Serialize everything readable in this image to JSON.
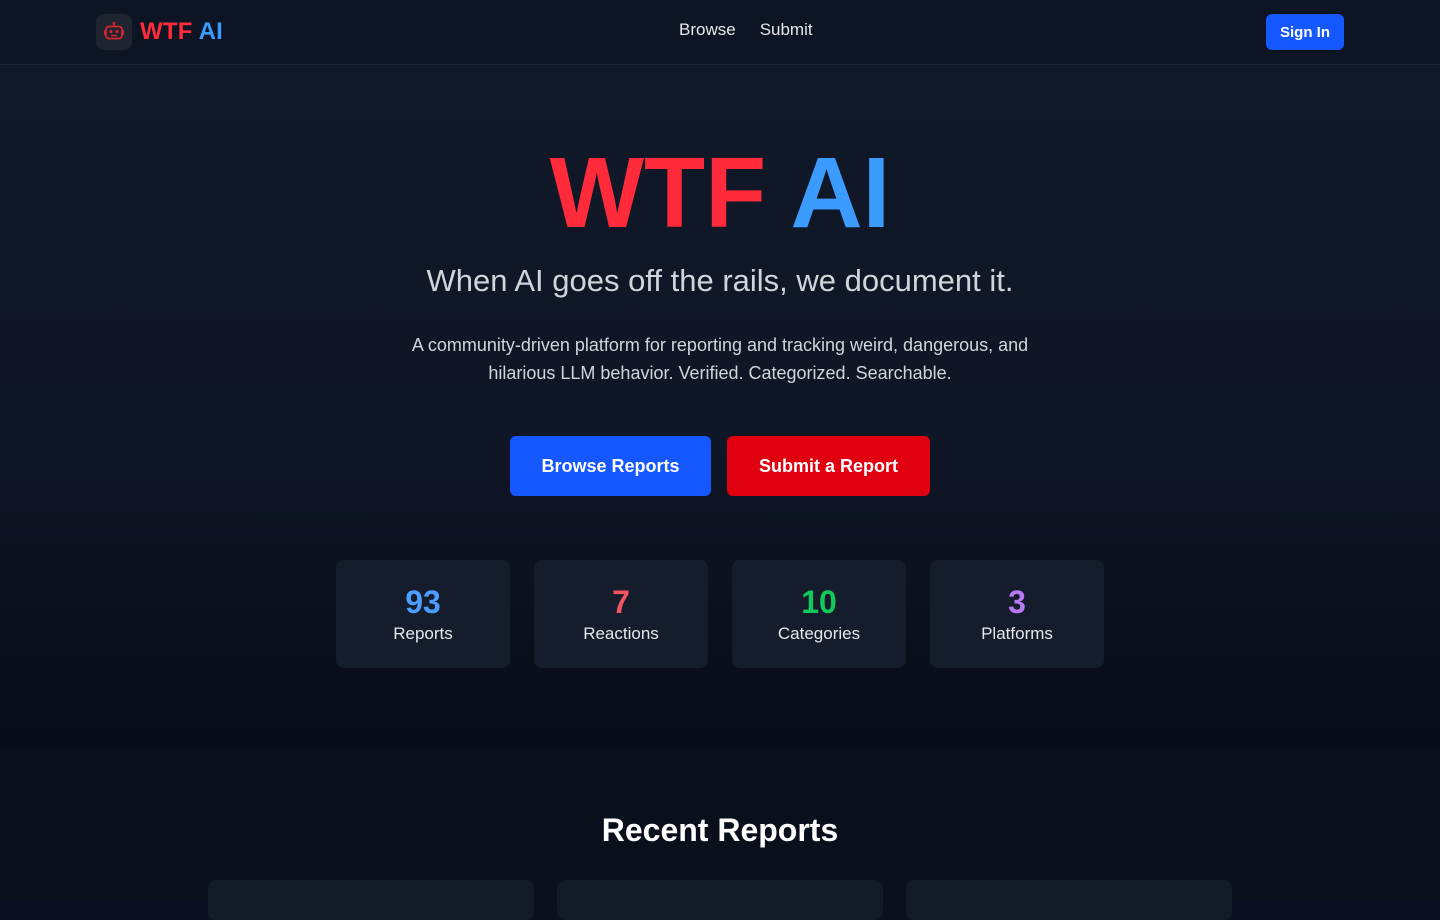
{
  "nav": {
    "logo": {
      "part1": "WTF",
      "part2": "AI",
      "icon": "robot-icon"
    },
    "links": [
      "Browse",
      "Submit"
    ],
    "signin": "Sign In"
  },
  "hero": {
    "title_part1": "WTF",
    "title_part2": "AI",
    "tagline": "When AI goes off the rails, we document it.",
    "description": "A community-driven platform for reporting and tracking weird, dangerous, and hilarious LLM behavior. Verified. Categorized. Searchable.",
    "browse_button": "Browse Reports",
    "submit_button": "Submit a Report"
  },
  "stats": [
    {
      "value": "93",
      "label": "Reports",
      "color": "#4b9dff"
    },
    {
      "value": "7",
      "label": "Reactions",
      "color": "#f0555e"
    },
    {
      "value": "10",
      "label": "Categories",
      "color": "#12c95c"
    },
    {
      "value": "3",
      "label": "Platforms",
      "color": "#b879f5"
    }
  ],
  "recent": {
    "title": "Recent Reports"
  },
  "colors": {
    "accent_red": "#ff2a3a",
    "accent_blue": "#3b9bff",
    "primary_button": "#1558ff",
    "danger_button": "#e00010"
  }
}
